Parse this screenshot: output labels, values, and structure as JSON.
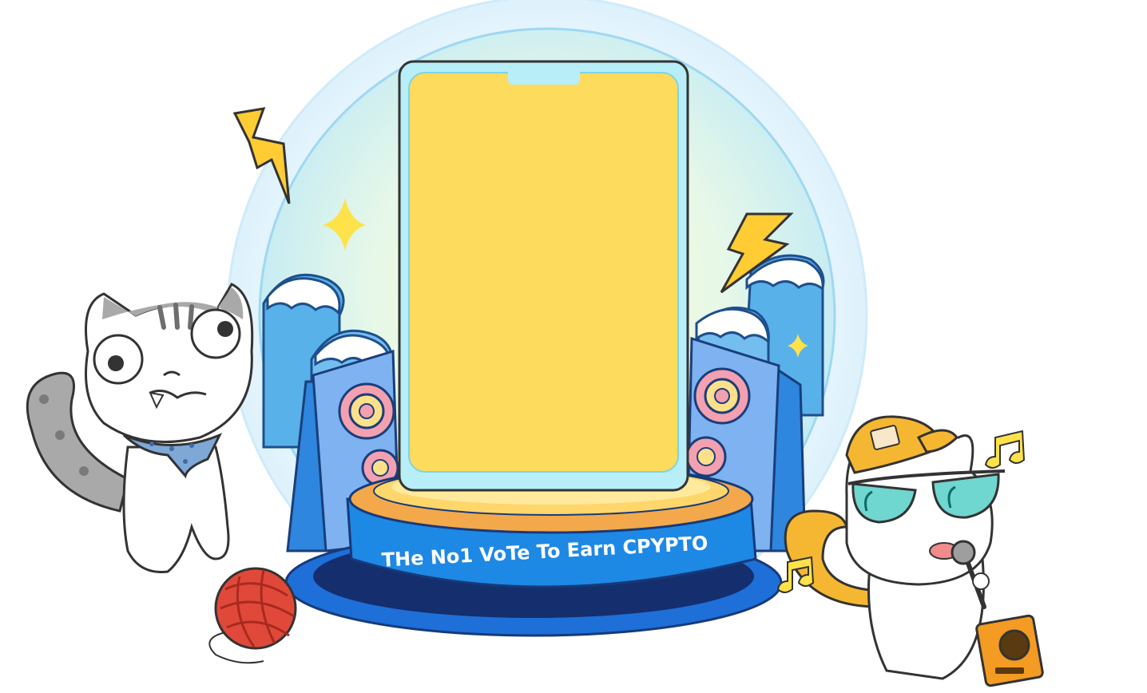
{
  "banner": {
    "text": "THe No1  VoTe To  Earn CPYPTO"
  },
  "phone": {
    "screen_color": "#FDDB5C",
    "bezel_color": "#B7EEF7"
  },
  "colors": {
    "stage_blue": "#1E88E5",
    "stage_dark": "#1A4FA8",
    "glow_outer": "#D8F0FB",
    "lightning": "#FFCC33",
    "yarn": "#E0493A",
    "cap": "#F5B731",
    "sunglasses": "#6FD6D0",
    "speaker_orange": "#F39B22"
  },
  "icons": {
    "left_character": "gray-cat-icon",
    "right_character": "white-cat-singer-icon",
    "yarn": "yarn-ball-icon",
    "music": "music-note-icon",
    "lightning": "lightning-bolt-icon",
    "sparkle": "sparkle-icon"
  }
}
